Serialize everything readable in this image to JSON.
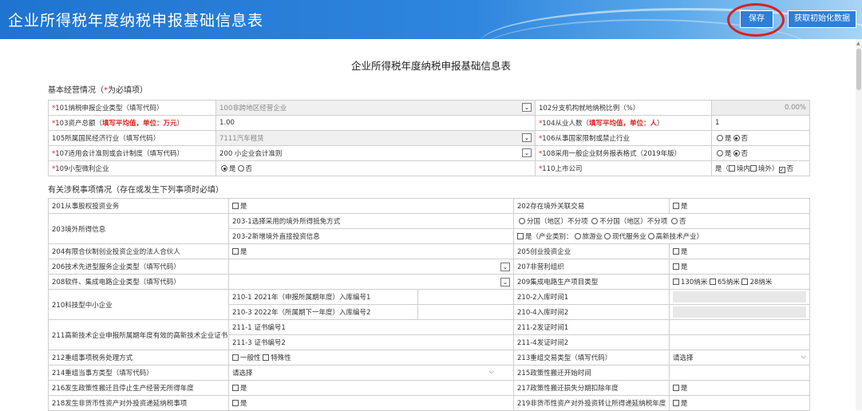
{
  "header": {
    "title": "企业所得税年度纳税申报基础信息表",
    "save_label": "保存",
    "init_label": "获取初始化数据"
  },
  "form_title": "企业所得税年度纳税申报基础信息表",
  "section1": {
    "prefix": "基本经营情况（",
    "star": "*",
    "suffix": "为必填项）"
  },
  "t1": {
    "r101": {
      "star": "*",
      "label": "101纳税申报企业类型（填写代码）",
      "value": "100非跨地区经营企业",
      "l2": "102分支机构就地纳税比例（%）",
      "v2": "0.00%"
    },
    "r103": {
      "star": "*",
      "label": "103资产总额（",
      "note": "填写平均值，单位：万元",
      "close": "）",
      "value": "1.00",
      "s2": "*",
      "l2": "104从业人数（",
      "n2": "填写平均值，单位：人",
      "c2": "）",
      "v2": "1"
    },
    "r105": {
      "label": "105所属国民经济行业（填写代码）",
      "value": "7111汽车租赁",
      "s2": "*",
      "l2": "106从事国家限制或禁止行业",
      "yes": "是",
      "no": "否"
    },
    "r107": {
      "star": "*",
      "label": "107适用会计准则或会计制度（填写代码）",
      "value": "200 小企业会计准则",
      "s2": "*",
      "l2": "108采用一般企业财务报表格式（2019年版）",
      "yes": "是",
      "no": "否"
    },
    "r109": {
      "star": "*",
      "label": "109小型微利企业",
      "yes": "是",
      "no": "否",
      "s2": "*",
      "l2": "110上市公司",
      "v_pre": "是（",
      "inner": "境内",
      "outer": "境外）",
      "no2": "否"
    }
  },
  "section2": "有关涉税事项情况（存在或发生下列事项时必填）",
  "t2": {
    "r201": {
      "l": "201从事股权投资业务",
      "cb": "是",
      "l2": "202存在境外关联交易",
      "cb2": "是"
    },
    "r203": {
      "l": "203境外所得信息",
      "a": "203-1选择采用的境外所得抵免方式",
      "a_opts": [
        "分国（地区）不分项",
        "不分国（地区）不分项",
        "否"
      ],
      "b": "203-2新增境外直接投资信息",
      "b_cb": "是",
      "b_mid": "（产业类别：",
      "b_opts": [
        "旅游业",
        "现代服务业",
        "高新技术产业"
      ],
      "b_end": "）"
    },
    "r204": {
      "l": "204有限合伙制创业投资企业的法人合伙人",
      "cb": "是",
      "l2": "205创业投资企业",
      "cb2": "是"
    },
    "r206": {
      "l": "206技术先进型服务企业类型（填写代码）",
      "l2": "207非营利组织",
      "cb2": "是"
    },
    "r208": {
      "l": "208软件、集成电路企业类型（填写代码）",
      "l2": "209集成电路生产项目类型",
      "opts": [
        "130纳米",
        "65纳米",
        "28纳米"
      ]
    },
    "r210": {
      "l": "210科技型中小企业",
      "a": "210-1  2021年（申报所属期年度）入库编号1",
      "a2": "210-2入库时间1",
      "b": "210-3  2022年（所属期下一年度）入库编号2",
      "b2": "210-4入库时间2"
    },
    "r211": {
      "l": "211高新技术企业申报所属期年度有效的高新技术企业证书",
      "a": "211-1 证书编号1",
      "a2": "211-2发证时间1",
      "b": "211-3 证书编号2",
      "b2": "211-4发证时间2"
    },
    "r212": {
      "l": "212重组事项税务处理方式",
      "o1": "一般性",
      "o2": "特殊性",
      "l2": "213重组交易类型（填写代码）",
      "sel2": "请选择"
    },
    "r214": {
      "l": "214重组当事方类型（填写代码）",
      "sel": "请选择",
      "l2": "215政策性搬迁开始时间"
    },
    "r216": {
      "l": "216发生政策性搬迁且停止生产经营无所得年度",
      "cb": "是",
      "l2": "217政策性搬迁损失分期扣除年度",
      "cb2": "是"
    },
    "r218": {
      "l": "218发生非货币性资产对外投资递延纳税事项",
      "cb": "是",
      "l2": "219非货币性资产对外投资转让所得递延纳税年度",
      "cb2": "是"
    }
  }
}
